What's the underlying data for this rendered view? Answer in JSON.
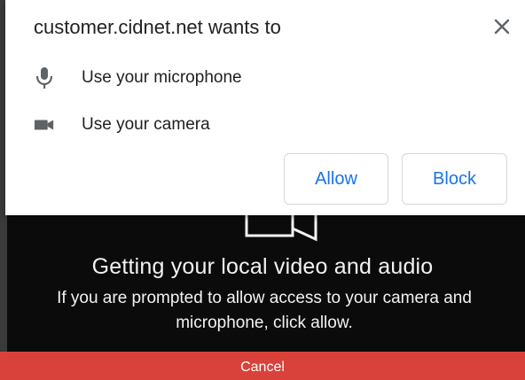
{
  "prompt": {
    "title": "customer.cidnet.net wants to",
    "permissions": [
      {
        "icon": "microphone-icon",
        "label": "Use your microphone"
      },
      {
        "icon": "camera-icon",
        "label": "Use your camera"
      }
    ],
    "allow_label": "Allow",
    "block_label": "Block",
    "close_icon": "close-icon",
    "accent_color": "#1a73e8"
  },
  "app": {
    "heading": "Getting your local video and audio",
    "message": "If you are prompted to allow access to your camera and microphone, click allow.",
    "cancel_label": "Cancel",
    "cancel_color": "#d9423a",
    "background_color": "#0b0b0b"
  }
}
